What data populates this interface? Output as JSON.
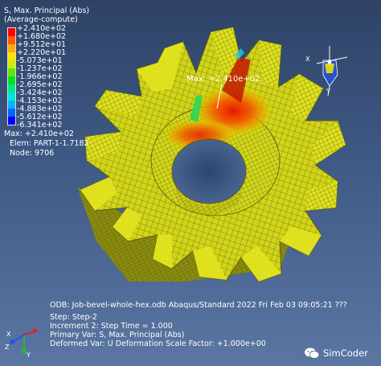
{
  "legend": {
    "title_line1": "S, Max. Principal (Abs)",
    "title_line2": "(Average-compute)",
    "values": [
      "+2.410e+02",
      "+1.680e+02",
      "+9.512e+01",
      "+2.220e+01",
      "-5.073e+01",
      "-1.237e+02",
      "-1.966e+02",
      "-2.695e+02",
      "-3.424e+02",
      "-4.153e+02",
      "-4.883e+02",
      "-5.612e+02",
      "-6.341e+02"
    ],
    "colors": [
      "#ff0000",
      "#ff5a00",
      "#ffaa00",
      "#ffe000",
      "#c8f000",
      "#5ee600",
      "#00e02a",
      "#00e68c",
      "#00e6d2",
      "#00b4ff",
      "#0064ff",
      "#0000ff"
    ],
    "max_label": "Max: +2.410e+02",
    "elem_label": "Elem: PART-1-1.7182",
    "node_label": "Node: 9706"
  },
  "annotation": {
    "max_label": "Max: +2.410e+02"
  },
  "status": {
    "odb": "ODB: Job-bevel-whole-hex.odb    Abaqus/Standard 2022    Fri Feb 03 09:05:21 ???",
    "step": "Step: Step-2",
    "increment": "Increment     2: Step Time =    1.000",
    "primary_var": "Primary Var: S, Max. Principal (Abs)",
    "deformed_var": "Deformed Var: U   Deformation Scale Factor: +1.000e+00"
  },
  "triad": {
    "x": "X",
    "y": "Y",
    "z": "Z"
  },
  "watermark": {
    "text": "SimCoder",
    "icon": "wechat-icon"
  },
  "icons": [
    "coordinate-triad-icon",
    "wechat-icon"
  ]
}
